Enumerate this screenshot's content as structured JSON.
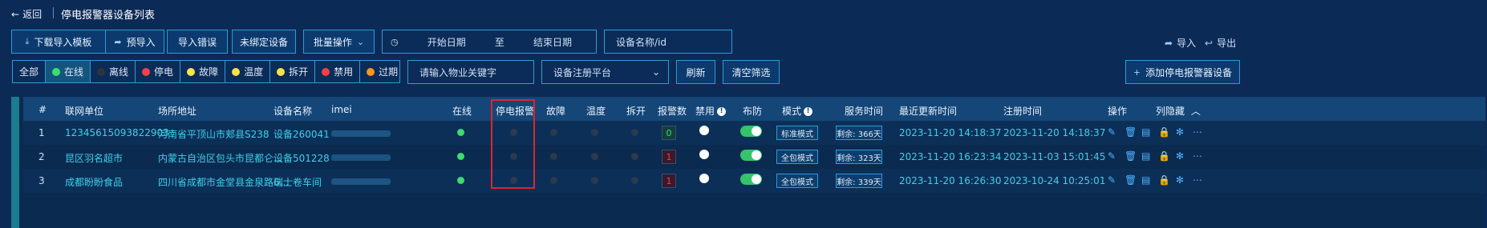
{
  "header": {
    "back_label": "返回",
    "title": "停电报警器设备列表"
  },
  "toolbar": {
    "download_template": "下载导入模板",
    "pre_import": "预导入",
    "import_error": "导入错误",
    "unbound": "未绑定设备",
    "batch": "批量操作",
    "start_date": "开始日期",
    "date_sep": "至",
    "end_date": "结束日期",
    "device_search": "设备名称/id",
    "import": "导入",
    "export": "导出"
  },
  "filters": {
    "statuses": [
      {
        "label": "全部",
        "color": ""
      },
      {
        "label": "在线",
        "color": "#3ddc6f"
      },
      {
        "label": "离线",
        "color": "#2c3442"
      },
      {
        "label": "停电",
        "color": "#f0414b"
      },
      {
        "label": "故障",
        "color": "#f6e24a"
      },
      {
        "label": "温度",
        "color": "#f6e24a"
      },
      {
        "label": "拆开",
        "color": "#f6e24a"
      },
      {
        "label": "禁用",
        "color": "#f0414b"
      },
      {
        "label": "过期",
        "color": "#f5961e"
      }
    ],
    "property_placeholder": "请输入物业关键字",
    "platform_placeholder": "设备注册平台",
    "refresh": "刷新",
    "clear": "清空筛选",
    "add_device": "添加停电报警器设备"
  },
  "table": {
    "headers": {
      "index": "#",
      "unit": "联网单位",
      "address": "场所地址",
      "name": "设备名称",
      "imei": "imei",
      "online": "在线",
      "power": "停电报警",
      "fault": "故障",
      "temp": "温度",
      "open": "拆开",
      "alarms": "报警数",
      "disabled": "禁用",
      "arm": "布防",
      "mode": "模式",
      "service": "服务时间",
      "updated": "最近更新时间",
      "registered": "注册时间",
      "actions": "操作",
      "hide_cols": "列隐藏"
    },
    "rows": [
      {
        "index": "1",
        "unit": "12345615093822903",
        "address": "河南省平顶山市郏县S238",
        "name": "设备260041",
        "alarms": "0",
        "mode": "标准模式",
        "service": "剩余: 366天",
        "updated": "2023-11-20 14:18:37",
        "registered": "2023-11-20 14:18:37"
      },
      {
        "index": "2",
        "unit": "昆区羽名超市",
        "address": "内蒙古自治区包头市昆都仑...",
        "name": "设备501228",
        "alarms": "1",
        "mode": "全包模式",
        "service": "剩余: 323天",
        "updated": "2023-11-20 16:23:34",
        "registered": "2023-11-03 15:01:45"
      },
      {
        "index": "3",
        "unit": "成都盼盼食品",
        "address": "四川省成都市金堂县金泉路6...",
        "name": "瑞士卷车间",
        "alarms": "1",
        "mode": "全包模式",
        "service": "剩余: 339天",
        "updated": "2023-11-20 16:26:30",
        "registered": "2023-10-24 10:25:01"
      }
    ]
  }
}
